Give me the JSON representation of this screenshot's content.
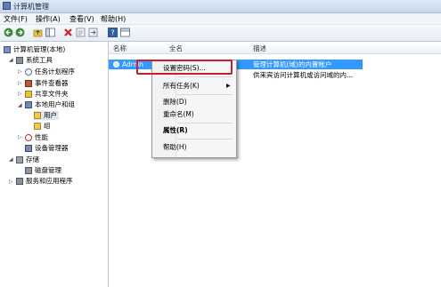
{
  "window": {
    "title": "计算机管理"
  },
  "menu": {
    "items": [
      "文件(F)",
      "操作(A)",
      "查看(V)",
      "帮助(H)"
    ]
  },
  "tree": {
    "root": "计算机管理(本地)",
    "system_tools": "系统工具",
    "task_scheduler": "任务计划程序",
    "event_viewer": "事件查看器",
    "shared_folders": "共享文件夹",
    "local_users_groups": "本地用户和组",
    "users": "用户",
    "groups": "组",
    "performance": "性能",
    "device_manager": "设备管理器",
    "storage": "存储",
    "disk_management": "磁盘管理",
    "services_apps": "服务和应用程序"
  },
  "list": {
    "columns": {
      "name": "名称",
      "fullname": "全名",
      "description": "描述"
    },
    "rows": [
      {
        "name": "Admin",
        "description": "管理计算机(域)的内置帐户"
      },
      {
        "name": "",
        "description": "供来宾访问计算机或访问域的内..."
      }
    ]
  },
  "context_menu": {
    "set_password": "设置密码(S)...",
    "all_tasks": "所有任务(K)",
    "delete": "删除(D)",
    "rename": "重命名(M)",
    "properties": "属性(R)",
    "help": "帮助(H)"
  },
  "colors": {
    "selection": "#3399ff",
    "highlight_box": "#cc1f2b"
  }
}
